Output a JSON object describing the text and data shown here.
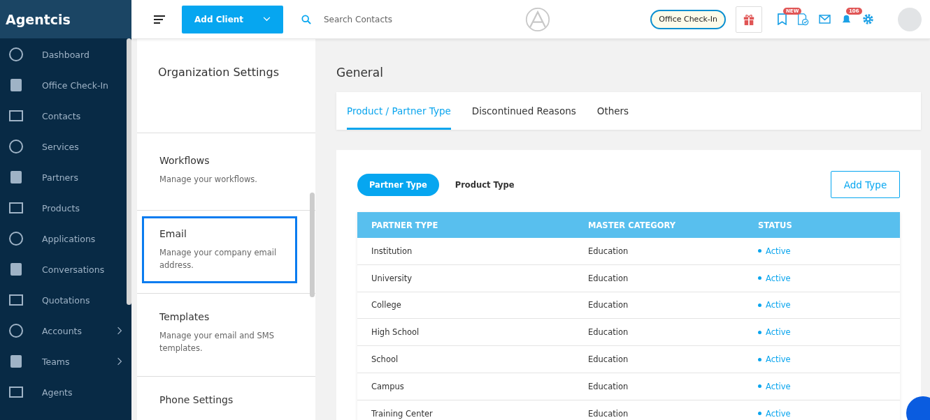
{
  "brand": "Agentcis",
  "sidebar": {
    "items": [
      {
        "label": "Dashboard",
        "has_submenu": false
      },
      {
        "label": "Office Check-In",
        "has_submenu": false
      },
      {
        "label": "Contacts",
        "has_submenu": false
      },
      {
        "label": "Services",
        "has_submenu": false
      },
      {
        "label": "Partners",
        "has_submenu": false
      },
      {
        "label": "Products",
        "has_submenu": false
      },
      {
        "label": "Applications",
        "has_submenu": false
      },
      {
        "label": "Conversations",
        "has_submenu": false
      },
      {
        "label": "Quotations",
        "has_submenu": false
      },
      {
        "label": "Accounts",
        "has_submenu": true
      },
      {
        "label": "Teams",
        "has_submenu": true
      },
      {
        "label": "Agents",
        "has_submenu": false
      }
    ]
  },
  "topbar": {
    "add_button": "Add Client",
    "search": {
      "placeholder": "Search Contacts"
    },
    "checkin_button": "Office Check-In",
    "new_badge": "NEW",
    "notification_count": "106"
  },
  "settings_panel": {
    "title": "Organization Settings",
    "items": [
      {
        "title": "Workflows",
        "description": "Manage your workflows.",
        "selected": false
      },
      {
        "title": "Email",
        "description": "Manage your company email address.",
        "selected": true
      },
      {
        "title": "Templates",
        "description": "Manage your email and SMS templates.",
        "selected": false
      },
      {
        "title": "Phone Settings",
        "selected": false
      }
    ]
  },
  "main": {
    "title": "General",
    "tabs": [
      {
        "label": "Product / Partner Type",
        "selected": true
      },
      {
        "label": "Discontinued Reasons",
        "selected": false
      },
      {
        "label": "Others",
        "selected": false
      }
    ],
    "type_toggle": [
      {
        "label": "Partner Type",
        "selected": true
      },
      {
        "label": "Product Type",
        "selected": false
      }
    ],
    "add_button": "Add Type",
    "table": {
      "columns": [
        "PARTNER TYPE",
        "MASTER CATEGORY",
        "STATUS"
      ],
      "rows": [
        {
          "name": "Institution",
          "category": "Education",
          "status": "Active"
        },
        {
          "name": "University",
          "category": "Education",
          "status": "Active"
        },
        {
          "name": "College",
          "category": "Education",
          "status": "Active"
        },
        {
          "name": "High School",
          "category": "Education",
          "status": "Active"
        },
        {
          "name": "School",
          "category": "Education",
          "status": "Active"
        },
        {
          "name": "Campus",
          "category": "Education",
          "status": "Active"
        },
        {
          "name": "Training Center",
          "category": "Education",
          "status": "Active"
        }
      ]
    }
  }
}
